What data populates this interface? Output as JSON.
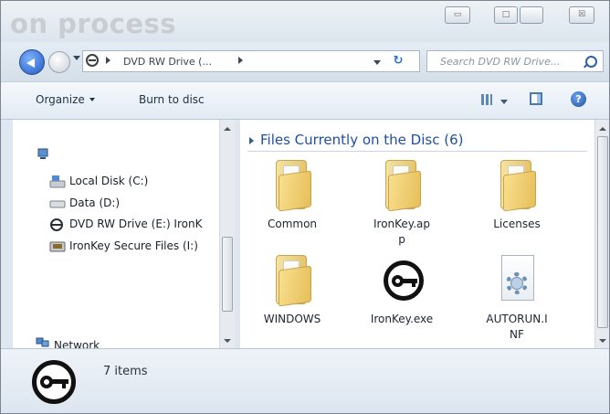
{
  "window": {
    "title": "on process",
    "controls": {
      "minimize": "▭",
      "maximize": "□",
      "close": "☒"
    }
  },
  "address": {
    "path": [
      "DVD RW Drive (..."
    ],
    "refresh_glyph": "↻",
    "search_placeholder": "Search DVD RW Drive..."
  },
  "toolbar": {
    "organize_label": "Organize",
    "burn_label": "Burn to disc",
    "help_glyph": "?"
  },
  "nav": {
    "items": [
      {
        "label": "Local Disk (C:)",
        "icon": "local-disk-icon"
      },
      {
        "label": "Data (D:)",
        "icon": "drive-icon"
      },
      {
        "label": "DVD RW Drive (E:) IronK",
        "icon": "dvd-drive-icon",
        "selected": true
      },
      {
        "label": "IronKey Secure Files (I:)",
        "icon": "secure-drive-icon"
      }
    ],
    "network_label": "Network"
  },
  "content": {
    "group_header": "Files Currently on the Disc (6)",
    "items": [
      {
        "label": "Common",
        "icon": "folder-icon"
      },
      {
        "label": "IronKey.ap\np",
        "icon": "folder-icon"
      },
      {
        "label": "Licenses",
        "icon": "folder-icon"
      },
      {
        "label": "WINDOWS",
        "icon": "folder-icon"
      },
      {
        "label": "IronKey.exe",
        "icon": "ironkey-app-icon"
      },
      {
        "label": "AUTORUN.I\nNF",
        "icon": "setup-info-file-icon"
      }
    ]
  },
  "details": {
    "count_text": "7 items"
  },
  "colors": {
    "accent": "#1f4f9a",
    "toolbar_bg": "#e2ebf4",
    "selected_bg": "#ffffff"
  }
}
